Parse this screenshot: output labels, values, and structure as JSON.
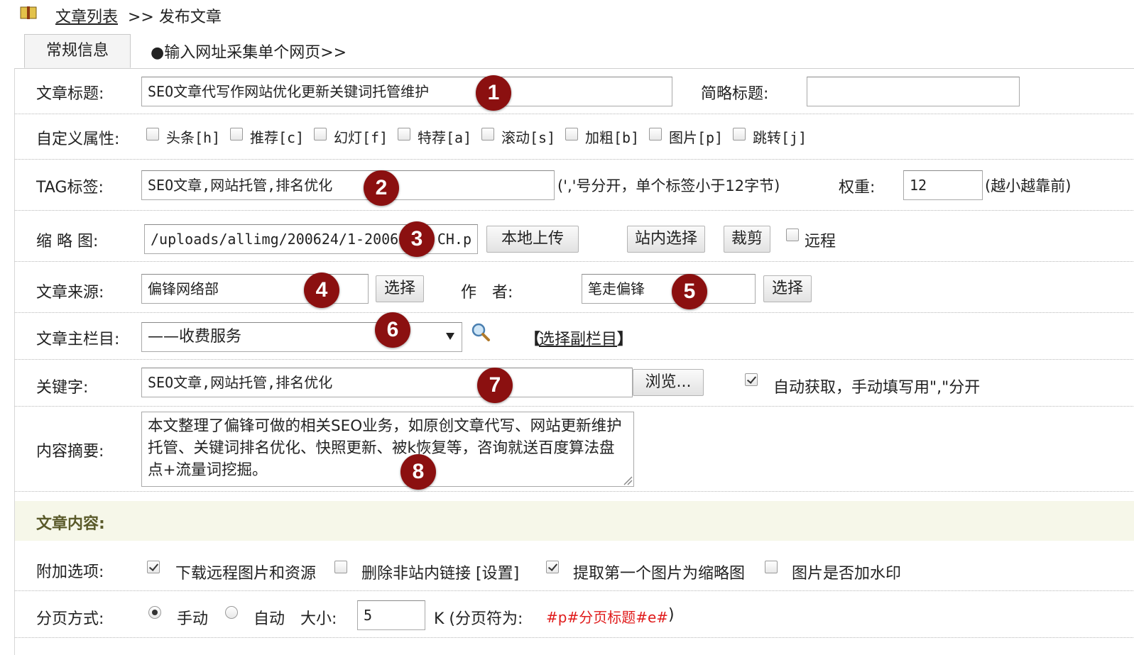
{
  "breadcrumb": {
    "link": "文章列表",
    "separator_text": ">> 发布文章"
  },
  "tabs": {
    "active": "常规信息",
    "collect_link": "●输入网址采集单个网页>>"
  },
  "form": {
    "title": {
      "label": "文章标题:",
      "value": "SEO文章代写作网站优化更新关键词托管维护",
      "short_label": "简略标题:",
      "short_value": ""
    },
    "flags": {
      "label": "自定义属性:",
      "items": [
        {
          "text": "头条[h]",
          "checked": false
        },
        {
          "text": "推荐[c]",
          "checked": false
        },
        {
          "text": "幻灯[f]",
          "checked": false
        },
        {
          "text": "特荐[a]",
          "checked": false
        },
        {
          "text": "滚动[s]",
          "checked": false
        },
        {
          "text": "加粗[b]",
          "checked": false
        },
        {
          "text": "图片[p]",
          "checked": false
        },
        {
          "text": "跳转[j]",
          "checked": false
        }
      ]
    },
    "tags": {
      "label": "TAG标签:",
      "value": "SEO文章,网站托管,排名优化",
      "hint": "(','号分开，单个标签小于12字节)",
      "weight_label": "权重:",
      "weight_value": "12",
      "weight_hint": "(越小越靠前)"
    },
    "thumb": {
      "label": "缩 略 图:",
      "value": "/uploads/allimg/200624/1-200624",
      "value_tail": "CH.p",
      "upload_btn": "本地上传",
      "site_btn": "站内选择",
      "crop_btn": "裁剪",
      "remote_label": "远程",
      "remote_checked": false
    },
    "source": {
      "label": "文章来源:",
      "value": "偏锋网络部",
      "select_btn": "选择",
      "author_label": "作　者:",
      "author_value": "笔走偏锋",
      "author_btn": "选择"
    },
    "category": {
      "label": "文章主栏目:",
      "value": "——收费服务",
      "sub_link": "选择副栏目",
      "sub_left": "【",
      "sub_right": "】"
    },
    "keywords": {
      "label": "关键字:",
      "value": "SEO文章,网站托管,排名优化",
      "browse_btn": "浏览...",
      "auto_label": "自动获取，手动填写用\",\"分开",
      "auto_checked": true
    },
    "summary": {
      "label": "内容摘要:",
      "value": "本文整理了偏锋可做的相关SEO业务，如原创文章代写、网站更新维护托管、关键词排名优化、快照更新、被k恢复等，咨询就送百度算法盘点+流量词挖掘。"
    },
    "content_section": "文章内容:",
    "options": {
      "label": "附加选项:",
      "items": [
        {
          "text": "下载远程图片和资源",
          "checked": true
        },
        {
          "text": "删除非站内链接 [设置]",
          "checked": false
        },
        {
          "text": "提取第一个图片为缩略图",
          "checked": true
        },
        {
          "text": "图片是否加水印",
          "checked": false
        }
      ]
    },
    "paging": {
      "label": "分页方式:",
      "manual": "手动",
      "auto": "自动",
      "size_label": "大小:",
      "size_value": "5",
      "unit_text": "K (分页符为:",
      "marker": "#p#分页标题#e#",
      "close": ")"
    }
  },
  "badges": [
    "1",
    "2",
    "3",
    "4",
    "5",
    "6",
    "7",
    "8"
  ],
  "colors": {
    "badge": "#8b1010",
    "marker": "#e01b1b",
    "section_bg": "#f6f7e9"
  }
}
